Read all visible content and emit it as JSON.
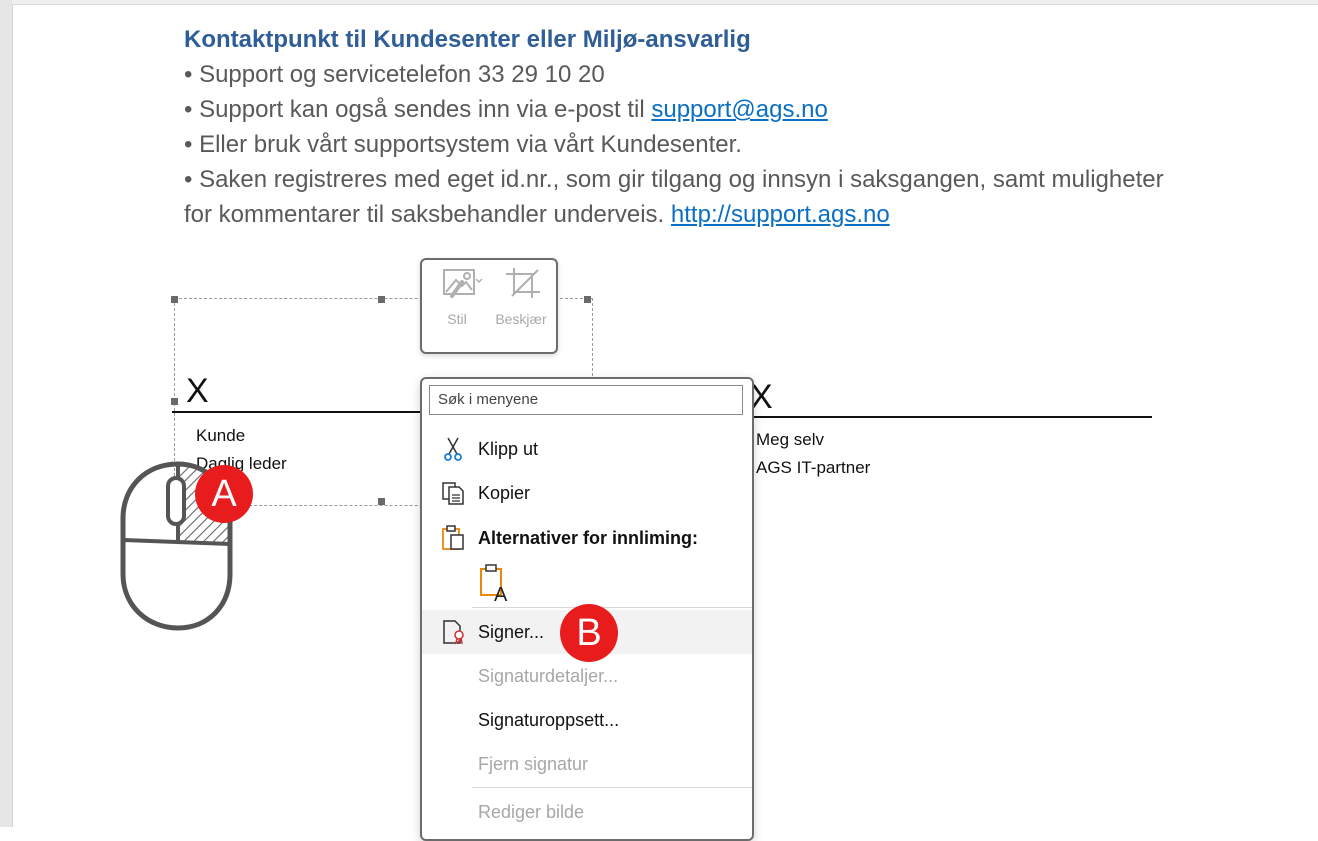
{
  "document": {
    "title": "Kontaktpunkt til Kundesenter eller Miljø-ansvarlig",
    "bullets": [
      "• Support og servicetelefon 33 29 10 20",
      "• Support kan også sendes inn via e-post til",
      "• Eller bruk vårt supportsystem via vårt Kundesenter.",
      "• Saken registreres med eget id.nr., som gir tilgang og innsyn i saksgangen, samt muligheter"
    ],
    "email_link": "support@ags.no",
    "continuation": "for kommentarer til saksbehandler underveis.",
    "url_link": "http://support.ags.no"
  },
  "signature_left": {
    "mark": "X",
    "name": "Kunde",
    "role": "Daglig leder"
  },
  "signature_right": {
    "mark": "X",
    "name": "Meg selv",
    "role": "AGS IT-partner"
  },
  "mini_toolbar": {
    "style_label": "Stil",
    "crop_label": "Beskjær"
  },
  "context_menu": {
    "search_placeholder": "Søk i menyene",
    "cut": "Klipp ut",
    "copy": "Kopier",
    "paste_options": "Alternativer for innliming:",
    "sign": "Signer...",
    "signature_details": "Signaturdetaljer...",
    "signature_setup": "Signaturoppsett...",
    "remove_signature": "Fjern signatur",
    "edit_picture": "Rediger bilde"
  },
  "annotations": {
    "a": "A",
    "b": "B"
  },
  "colors": {
    "heading": "#2f5e97",
    "link": "#0b6fc4",
    "badge": "#e81c1c",
    "icon_accent": "#e8890c"
  },
  "icons": [
    "picture-style-icon",
    "crop-icon",
    "scissors-icon",
    "copy-icon",
    "paste-icon",
    "paste-text-icon",
    "sign-document-icon",
    "mouse-icon"
  ]
}
